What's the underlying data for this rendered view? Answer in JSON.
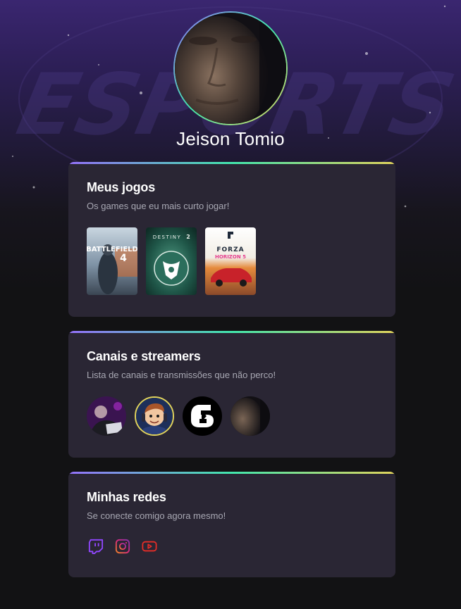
{
  "profile": {
    "name": "Jeison Tomio"
  },
  "games": {
    "title": "Meus jogos",
    "subtitle": "Os games que eu mais curto jogar!",
    "items": [
      {
        "name": "Battlefield 4",
        "logo_line1": "BATTLEFIELD",
        "logo_line2": "4"
      },
      {
        "name": "Destiny 2",
        "logo_line1": "DESTINY",
        "logo_line2": "2"
      },
      {
        "name": "Forza Horizon 5",
        "logo_line1": "FORZA",
        "logo_line2": "HORIZON 5"
      }
    ]
  },
  "channels": {
    "title": "Canais e streamers",
    "subtitle": "Lista de canais e transmissões que não perco!",
    "items": [
      {
        "icon": "streamer-purple-avatar"
      },
      {
        "icon": "streamer-cartoon-avatar"
      },
      {
        "icon": "rainbow-six-logo"
      },
      {
        "icon": "streamer-face-avatar"
      }
    ]
  },
  "socials": {
    "title": "Minhas redes",
    "subtitle": "Se conecte comigo agora mesmo!",
    "items": [
      {
        "icon": "twitch-icon",
        "color": "#9147ff"
      },
      {
        "icon": "instagram-icon",
        "color": "#e1306c"
      },
      {
        "icon": "youtube-icon",
        "color": "#e52d27"
      }
    ]
  },
  "colors": {
    "background": "#121214",
    "card": "#2a2634",
    "gradient": [
      "#9572fc",
      "#43e7ad",
      "#e2d45c"
    ],
    "subtitle": "#a8a8b3"
  }
}
